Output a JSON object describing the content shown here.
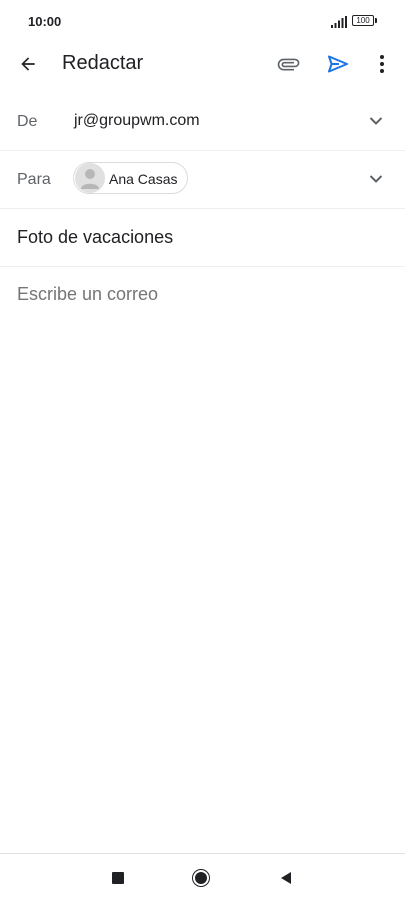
{
  "status_bar": {
    "time": "10:00",
    "battery_level": "100",
    "signal_icon": "signal-bars-icon"
  },
  "app_bar": {
    "title": "Redactar",
    "back_icon": "arrow-back-icon",
    "attach_icon": "paperclip-icon",
    "send_icon": "send-icon",
    "more_icon": "more-vert-icon",
    "send_color": "#1a73e8"
  },
  "compose": {
    "from_label": "De",
    "from_value": "jr@groupwm.com",
    "to_label": "Para",
    "recipients": [
      {
        "name": "Ana Casas",
        "avatar_icon": "person-avatar-icon"
      }
    ],
    "subject": "Foto de vacaciones",
    "body_placeholder": "Escribe un correo"
  },
  "nav_bar": {
    "recent_icon": "square-recent-icon",
    "home_icon": "circle-home-icon",
    "back_icon": "triangle-back-icon"
  }
}
